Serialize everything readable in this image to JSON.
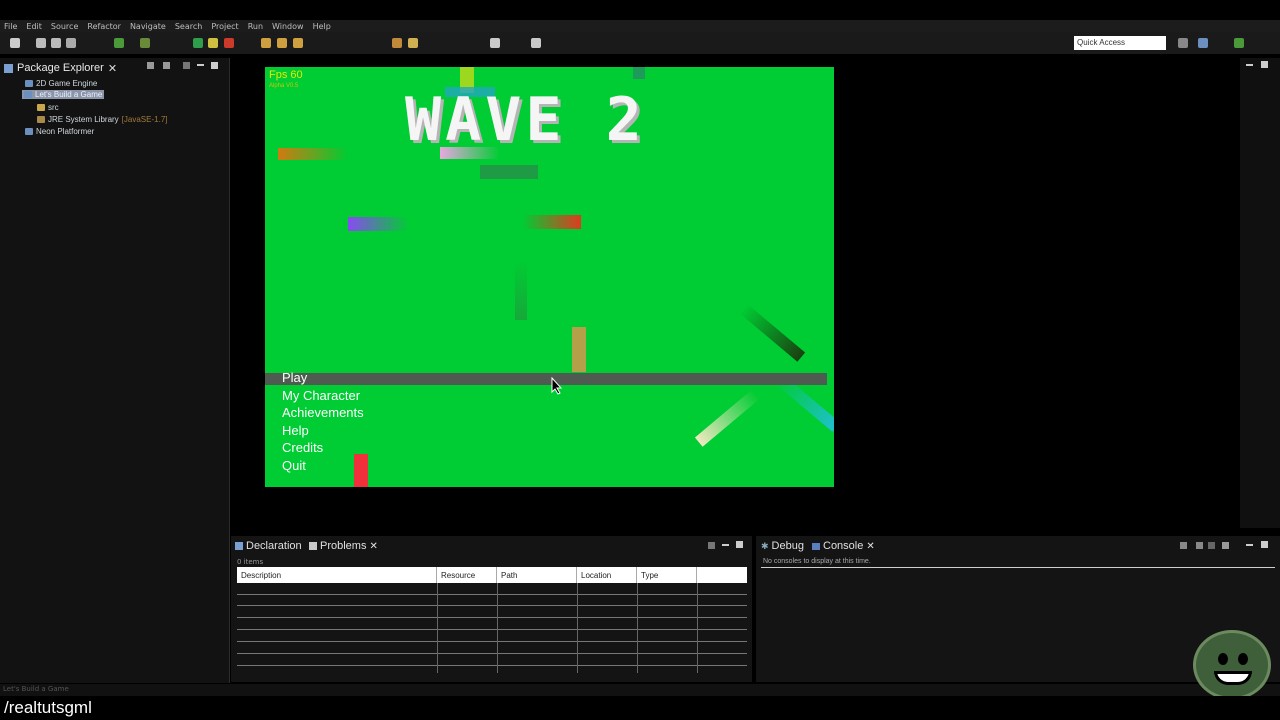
{
  "menubar": {
    "items": [
      "File",
      "Edit",
      "Source",
      "Refactor",
      "Navigate",
      "Search",
      "Project",
      "Run",
      "Window",
      "Help"
    ]
  },
  "toolbar": {
    "quick_access_placeholder": "Quick Access"
  },
  "package_explorer": {
    "title": "Package Explorer",
    "items": [
      {
        "label": "2D Game Engine",
        "type": "project"
      },
      {
        "label": "Let's Build a Game",
        "type": "project",
        "selected": true
      },
      {
        "label": "src",
        "type": "folder"
      },
      {
        "label": "JRE System Library",
        "suffix": "[JavaSE-1.7]",
        "type": "library"
      },
      {
        "label": "Neon Platformer",
        "type": "project"
      }
    ]
  },
  "game": {
    "fps": "Fps 60",
    "build": "Alpha V0.5",
    "wave_title": "WAVE 2",
    "background_color": "#00cc33",
    "menu": [
      "Play",
      "My Character",
      "Achievements",
      "Help",
      "Credits",
      "Quit"
    ],
    "selected_menu_item": "Play"
  },
  "bottom_left": {
    "tabs": [
      "Declaration",
      "Problems"
    ],
    "active_tab": "Problems",
    "items_count": "0 items",
    "columns": [
      "Description",
      "Resource",
      "Path",
      "Location",
      "Type"
    ]
  },
  "bottom_right": {
    "tabs": [
      "Debug",
      "Console"
    ],
    "active_tab": "Console",
    "message": "No consoles to display at this time."
  },
  "status": {
    "text": "Let's Build a Game"
  },
  "footer": {
    "channel": "/realtutsgml"
  }
}
